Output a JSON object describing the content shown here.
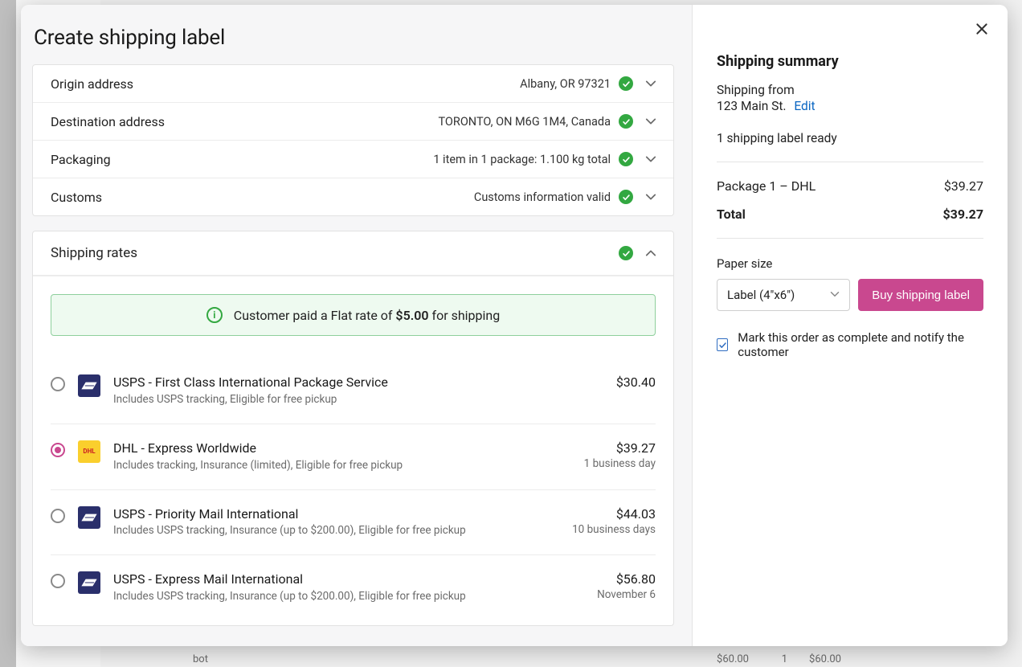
{
  "modal": {
    "title": "Create shipping label"
  },
  "panels": {
    "origin": {
      "label": "Origin address",
      "value": "Albany, OR  97321"
    },
    "destination": {
      "label": "Destination address",
      "value": "TORONTO, ON  M6G 1M4, Canada"
    },
    "packaging": {
      "label": "Packaging",
      "value": "1 item in 1 package: 1.100 kg total"
    },
    "customs": {
      "label": "Customs",
      "value": "Customs information valid"
    },
    "rates": {
      "label": "Shipping rates"
    }
  },
  "banner": {
    "prefix": "Customer paid a Flat rate of ",
    "amount": "$5.00",
    "suffix": " for shipping"
  },
  "rates": [
    {
      "carrier": "usps",
      "name": "USPS - First Class International Package Service",
      "sub": "Includes USPS tracking, Eligible for free pickup",
      "price": "$30.40",
      "eta": "",
      "selected": false
    },
    {
      "carrier": "dhl",
      "name": "DHL - Express Worldwide",
      "sub": "Includes tracking, Insurance (limited), Eligible for free pickup",
      "price": "$39.27",
      "eta": "1 business day",
      "selected": true
    },
    {
      "carrier": "usps",
      "name": "USPS - Priority Mail International",
      "sub": "Includes USPS tracking, Insurance (up to $200.00), Eligible for free pickup",
      "price": "$44.03",
      "eta": "10 business days",
      "selected": false
    },
    {
      "carrier": "usps",
      "name": "USPS - Express Mail International",
      "sub": "Includes USPS tracking, Insurance (up to $200.00), Eligible for free pickup",
      "price": "$56.80",
      "eta": "November 6",
      "selected": false
    }
  ],
  "summary": {
    "title": "Shipping summary",
    "from_label": "Shipping from",
    "from_addr": "123 Main St.",
    "edit": "Edit",
    "ready": "1 shipping label ready",
    "line_item_label": "Package 1 – DHL",
    "line_item_amount": "$39.27",
    "total_label": "Total",
    "total_amount": "$39.27",
    "paper_label": "Paper size",
    "paper_value": "Label (4\"x6\")",
    "buy_label": "Buy shipping label",
    "mark_label": "Mark this order as complete and notify the customer"
  },
  "background": {
    "bottom_left": "bot",
    "bottom_price": "$60.00",
    "bottom_qty": "1",
    "bottom_total": "$60.00"
  }
}
